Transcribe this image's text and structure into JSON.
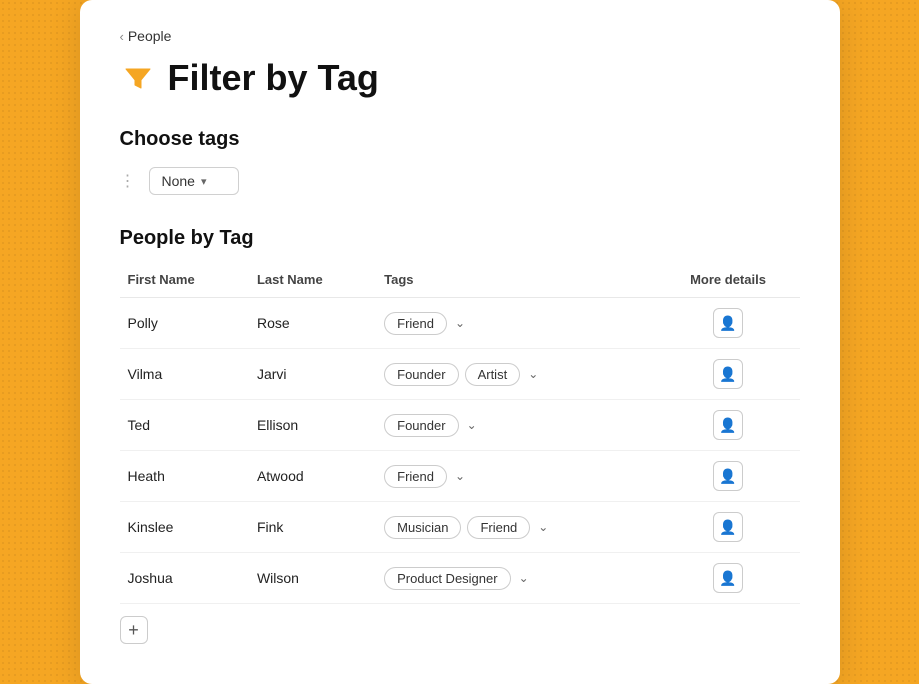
{
  "breadcrumb": {
    "chevron": "‹",
    "label": "People"
  },
  "header": {
    "title": "Filter by Tag",
    "filter_icon": "funnel"
  },
  "choose_tags": {
    "section_title": "Choose tags",
    "dropdown_label": "None",
    "dropdown_caret": "▾"
  },
  "people_by_tag": {
    "section_title": "People by Tag",
    "columns": {
      "first_name": "First Name",
      "last_name": "Last Name",
      "tags": "Tags",
      "more_details": "More details"
    },
    "rows": [
      {
        "first_name": "Polly",
        "last_name": "Rose",
        "tags": [
          "Friend"
        ]
      },
      {
        "first_name": "Vilma",
        "last_name": "Jarvi",
        "tags": [
          "Founder",
          "Artist"
        ]
      },
      {
        "first_name": "Ted",
        "last_name": "Ellison",
        "tags": [
          "Founder"
        ]
      },
      {
        "first_name": "Heath",
        "last_name": "Atwood",
        "tags": [
          "Friend"
        ]
      },
      {
        "first_name": "Kinslee",
        "last_name": "Fink",
        "tags": [
          "Musician",
          "Friend"
        ]
      },
      {
        "first_name": "Joshua",
        "last_name": "Wilson",
        "tags": [
          "Product Designer"
        ]
      }
    ]
  },
  "add_button_label": "+"
}
